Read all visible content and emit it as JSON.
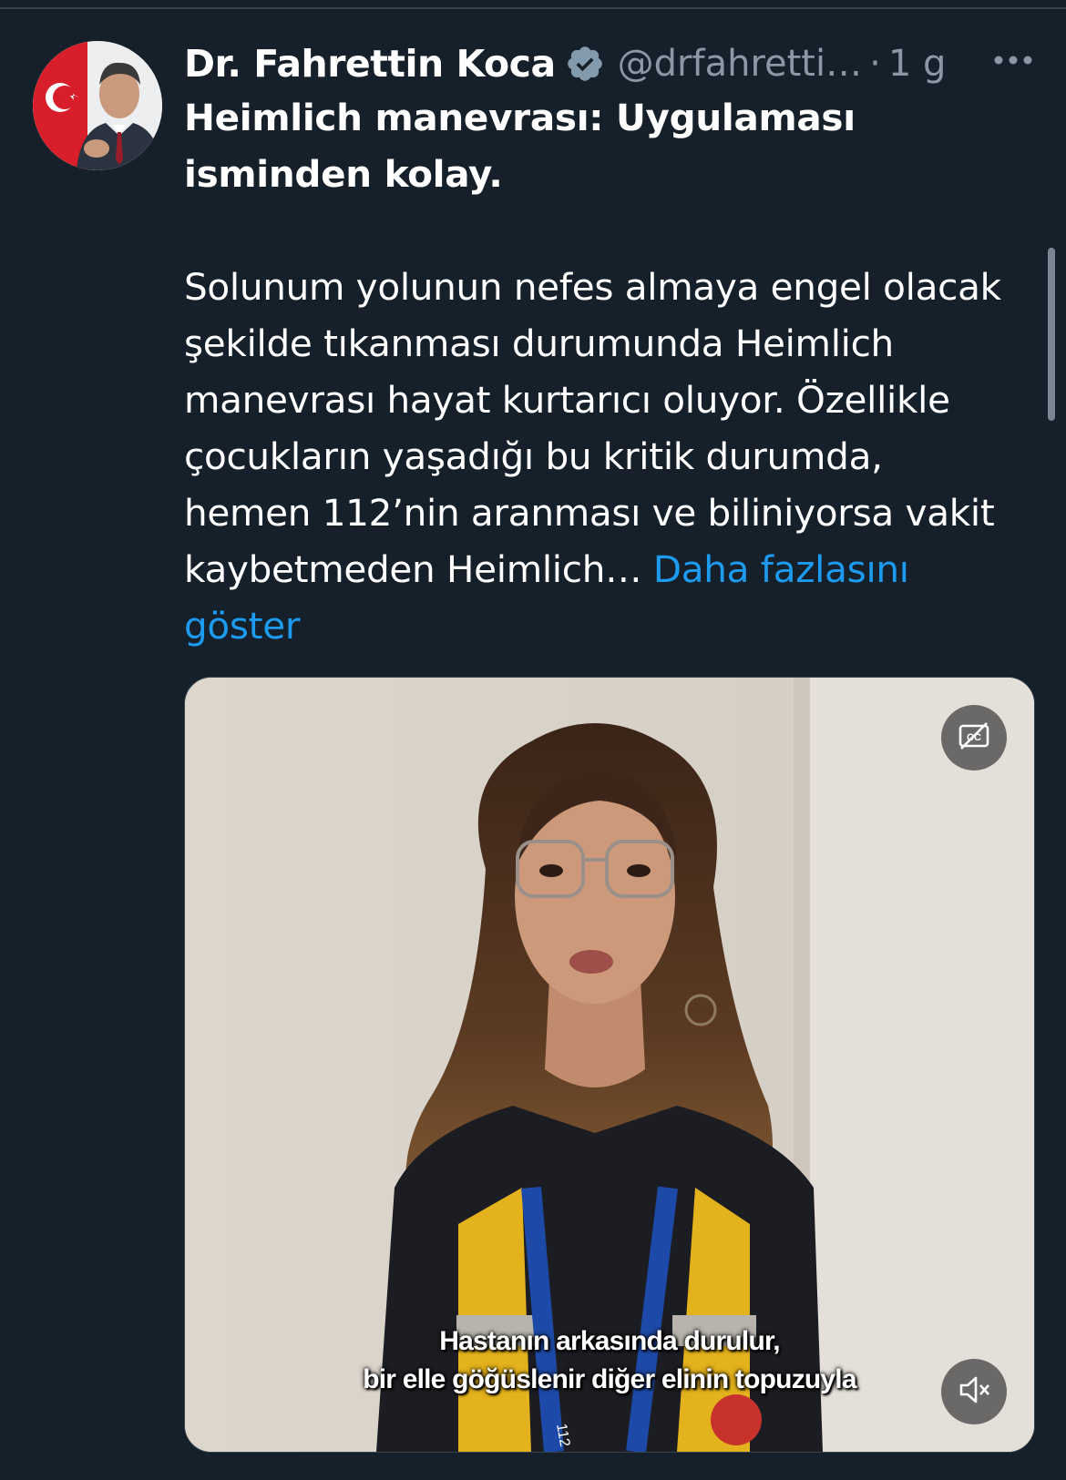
{
  "tweet": {
    "author": {
      "display_name": "Dr. Fahrettin Koca",
      "handle": "@drfahretti…",
      "separator": "·",
      "time": "1 g",
      "verified": true
    },
    "headline": "Heimlich manevrası: Uygulaması isminden kolay.",
    "body": "Solunum yolunun nefes almaya engel olacak şekilde tıkanması durumunda Heimlich manevrası hayat kurtarıcı oluyor. Özellikle çocukların yaşadığı bu kritik durumda, hemen 112’nin aranması ve biliniyorsa vakit kaybetmeden Heimlich…",
    "show_more_label": "Daha fazlasını göster"
  },
  "video": {
    "subtitle_line_1": "Hastanın arkasında durulur,",
    "subtitle_line_2": "bir elle göğüslenir diğer elinin topuzuyla",
    "badge_text": "112"
  },
  "icons": {
    "more": "more-horizontal-icon",
    "verified": "verified-badge-icon",
    "captions": "closed-captions-off-icon",
    "mute": "volume-muted-icon"
  },
  "colors": {
    "background": "#15202b",
    "text_primary": "#ffffff",
    "text_secondary": "#8b98a5",
    "link": "#1d9bf0",
    "border": "#38444d"
  }
}
